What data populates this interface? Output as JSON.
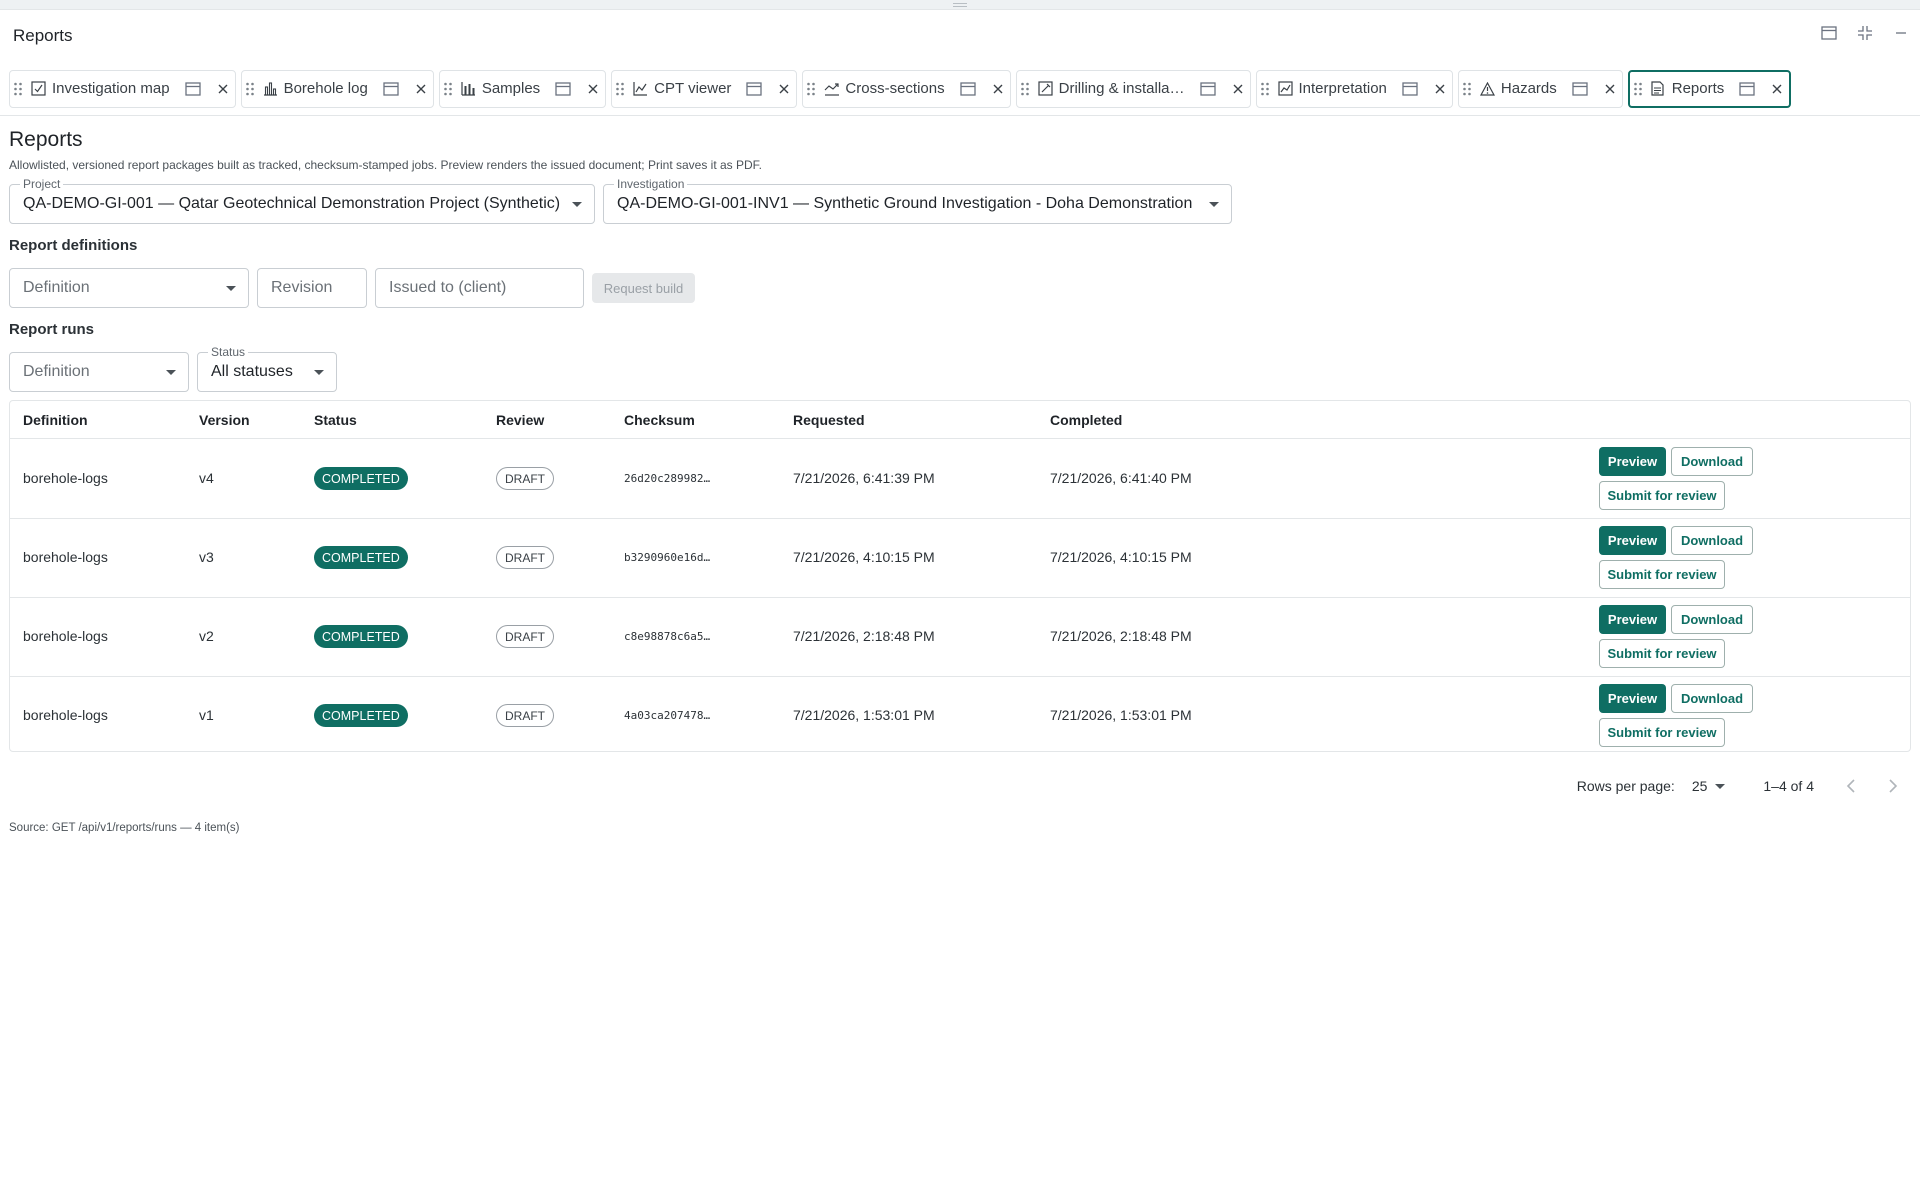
{
  "panel": {
    "title": "Reports"
  },
  "tabs": [
    {
      "label": "Investigation map",
      "icon": "map-check-icon"
    },
    {
      "label": "Borehole log",
      "icon": "bar-chart-icon"
    },
    {
      "label": "Samples",
      "icon": "samples-chart-icon"
    },
    {
      "label": "CPT viewer",
      "icon": "line-chart-icon"
    },
    {
      "label": "Cross-sections",
      "icon": "cross-section-icon"
    },
    {
      "label": "Drilling & installa…",
      "icon": "drilling-pencil-icon"
    },
    {
      "label": "Interpretation",
      "icon": "interpretation-icon"
    },
    {
      "label": "Hazards",
      "icon": "warning-triangle-icon"
    },
    {
      "label": "Reports",
      "icon": "report-document-icon",
      "active": true
    }
  ],
  "page": {
    "title": "Reports",
    "description": "Allowlisted, versioned report packages built as tracked, checksum-stamped jobs. Preview renders the issued document; Print saves it as PDF."
  },
  "filters": {
    "project_label": "Project",
    "project_value": "QA-DEMO-GI-001 — Qatar Geotechnical Demonstration Project (Synthetic)",
    "investigation_label": "Investigation",
    "investigation_value": "QA-DEMO-GI-001-INV1 — Synthetic Ground Investigation - Doha Demonstration"
  },
  "definitions_section": {
    "title": "Report definitions",
    "definition_placeholder": "Definition",
    "revision_placeholder": "Revision",
    "issued_to_placeholder": "Issued to (client)",
    "request_build_label": "Request build"
  },
  "runs_section": {
    "title": "Report runs",
    "definition_placeholder": "Definition",
    "status_label": "Status",
    "status_value": "All statuses"
  },
  "table": {
    "columns": [
      "Definition",
      "Version",
      "Status",
      "Review",
      "Checksum",
      "Requested",
      "Completed"
    ],
    "rows": [
      {
        "definition": "borehole-logs",
        "version": "v4",
        "status": "COMPLETED",
        "review": "DRAFT",
        "checksum": "26d20c289982…",
        "requested": "7/21/2026, 6:41:39 PM",
        "completed": "7/21/2026, 6:41:40 PM"
      },
      {
        "definition": "borehole-logs",
        "version": "v3",
        "status": "COMPLETED",
        "review": "DRAFT",
        "checksum": "b3290960e16d…",
        "requested": "7/21/2026, 4:10:15 PM",
        "completed": "7/21/2026, 4:10:15 PM"
      },
      {
        "definition": "borehole-logs",
        "version": "v2",
        "status": "COMPLETED",
        "review": "DRAFT",
        "checksum": "c8e98878c6a5…",
        "requested": "7/21/2026, 2:18:48 PM",
        "completed": "7/21/2026, 2:18:48 PM"
      },
      {
        "definition": "borehole-logs",
        "version": "v1",
        "status": "COMPLETED",
        "review": "DRAFT",
        "checksum": "4a03ca207478…",
        "requested": "7/21/2026, 1:53:01 PM",
        "completed": "7/21/2026, 1:53:01 PM"
      }
    ],
    "actions": {
      "preview": "Preview",
      "download": "Download",
      "submit": "Submit for review"
    }
  },
  "pagination": {
    "rows_per_page_label": "Rows per page:",
    "rows_per_page_value": "25",
    "range": "1–4 of 4"
  },
  "source_note": "Source: GET /api/v1/reports/runs — 4 item(s)",
  "colors": {
    "accent": "#0f6e63",
    "border": "#e3e6e8"
  }
}
